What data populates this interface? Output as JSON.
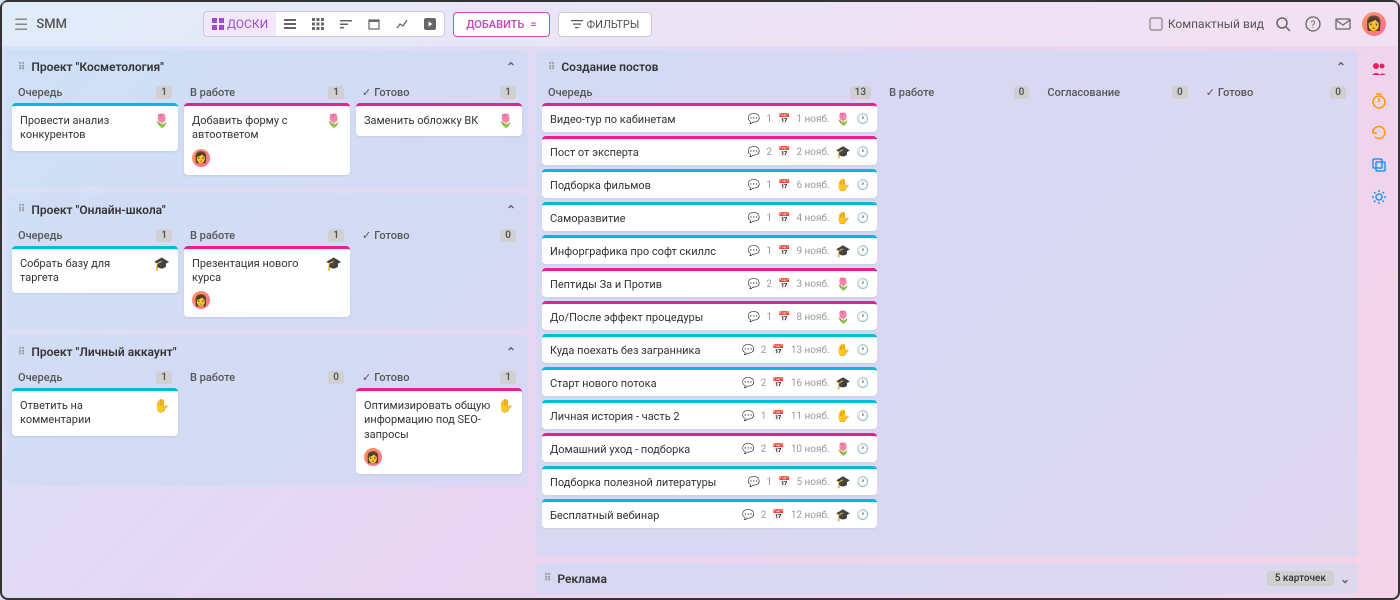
{
  "header": {
    "title": "SMM",
    "boards_label": "ДОСКИ",
    "add_label": "ДОБАВИТЬ",
    "filters_label": "ФИЛЬТРЫ",
    "compact_label": "Компактный вид"
  },
  "left_boards": [
    {
      "title": "Проект \"Косметология\"",
      "columns": [
        {
          "name": "Очередь",
          "count": "1",
          "done": false,
          "cards": [
            {
              "title": "Провести анализ конкурентов",
              "color": "teal",
              "icon": "🌷",
              "avatar": false
            }
          ]
        },
        {
          "name": "В работе",
          "count": "1",
          "done": false,
          "cards": [
            {
              "title": "Добавить форму с автоответом",
              "color": "pink",
              "icon": "🌷",
              "avatar": true
            }
          ]
        },
        {
          "name": "Готово",
          "count": "1",
          "done": true,
          "cards": [
            {
              "title": "Заменить обложку ВК",
              "color": "pink",
              "icon": "🌷",
              "avatar": false
            }
          ]
        }
      ]
    },
    {
      "title": "Проект \"Онлайн-школа\"",
      "columns": [
        {
          "name": "Очередь",
          "count": "1",
          "done": false,
          "cards": [
            {
              "title": "Собрать базу для таргета",
              "color": "teal",
              "icon": "🎓",
              "avatar": false
            }
          ]
        },
        {
          "name": "В работе",
          "count": "1",
          "done": false,
          "cards": [
            {
              "title": "Презентация нового курса",
              "color": "pink",
              "icon": "🎓",
              "avatar": true
            }
          ]
        },
        {
          "name": "Готово",
          "count": "0",
          "done": true,
          "cards": []
        }
      ]
    },
    {
      "title": "Проект \"Личный аккаунт\"",
      "columns": [
        {
          "name": "Очередь",
          "count": "1",
          "done": false,
          "cards": [
            {
              "title": "Ответить на комментарии",
              "color": "teal",
              "icon": "✋",
              "avatar": false
            }
          ]
        },
        {
          "name": "В работе",
          "count": "0",
          "done": false,
          "cards": []
        },
        {
          "name": "Готово",
          "count": "1",
          "done": true,
          "cards": [
            {
              "title": "Оптимизировать общую информацию под SEO-запросы",
              "color": "pink",
              "icon": "✋",
              "avatar": true
            }
          ]
        }
      ]
    }
  ],
  "big_board": {
    "title": "Создание постов",
    "columns": [
      {
        "name": "Очередь",
        "count": "13",
        "done": false,
        "wide": true
      },
      {
        "name": "В работе",
        "count": "0",
        "done": false,
        "wide": false
      },
      {
        "name": "Согласование",
        "count": "0",
        "done": false,
        "wide": false
      },
      {
        "name": "Готово",
        "count": "0",
        "done": true,
        "wide": false
      }
    ],
    "rows": [
      {
        "title": "Видео-тур по кабинетам",
        "color": "pink",
        "comments": "1",
        "date": "1 нояб.",
        "icon": "🌷"
      },
      {
        "title": "Пост от эксперта",
        "color": "pink",
        "comments": "2",
        "date": "2 нояб.",
        "icon": "🎓"
      },
      {
        "title": "Подборка фильмов",
        "color": "teal",
        "comments": "1",
        "date": "6 нояб.",
        "icon": "✋"
      },
      {
        "title": "Саморазвитие",
        "color": "teal",
        "comments": "1",
        "date": "4 нояб.",
        "icon": "✋"
      },
      {
        "title": "Инфорграфика про софт скиллс",
        "color": "teal",
        "comments": "1",
        "date": "9 нояб.",
        "icon": "🎓"
      },
      {
        "title": "Пептиды За и Против",
        "color": "pink",
        "comments": "2",
        "date": "3 нояб.",
        "icon": "🌷"
      },
      {
        "title": "До/После эффект процедуры",
        "color": "pink",
        "comments": "1",
        "date": "8 нояб.",
        "icon": "🌷"
      },
      {
        "title": "Куда поехать без загранника",
        "color": "teal",
        "comments": "2",
        "date": "13 нояб.",
        "icon": "✋"
      },
      {
        "title": "Старт нового потока",
        "color": "teal",
        "comments": "2",
        "date": "16 нояб.",
        "icon": "🎓"
      },
      {
        "title": "Личная история - часть 2",
        "color": "teal",
        "comments": "1",
        "date": "11 нояб.",
        "icon": "✋"
      },
      {
        "title": "Домашний уход - подборка",
        "color": "pink",
        "comments": "2",
        "date": "10 нояб.",
        "icon": "🌷"
      },
      {
        "title": "Подборка полезной литературы",
        "color": "teal",
        "comments": "1",
        "date": "5 нояб.",
        "icon": "🎓"
      },
      {
        "title": "Бесплатный вебинар",
        "color": "teal",
        "comments": "2",
        "date": "12 нояб.",
        "icon": "🎓"
      }
    ]
  },
  "collapsed_board": {
    "title": "Реклама",
    "count": "5 карточек"
  }
}
